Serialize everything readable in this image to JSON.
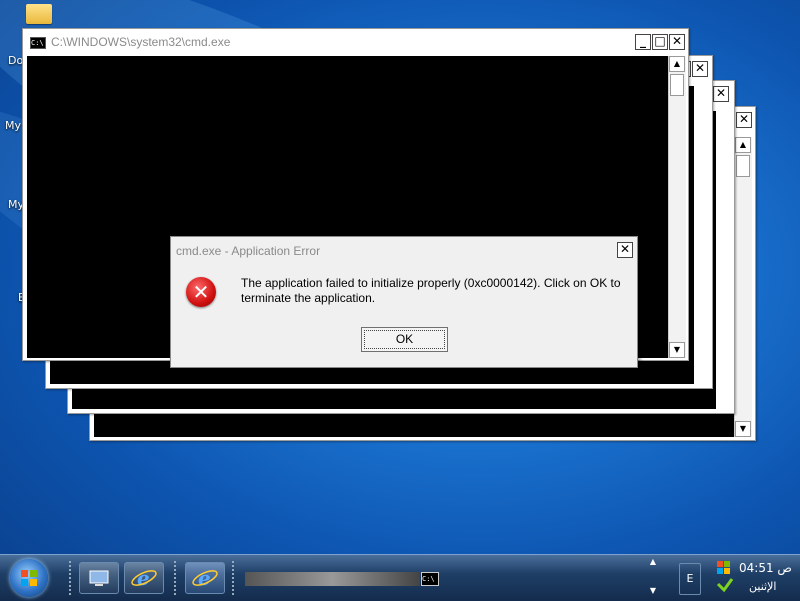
{
  "desktop": {
    "icon_labels": [
      "Do",
      "My",
      "My",
      "E"
    ]
  },
  "windows": {
    "cmd_title": "C:\\WINDOWS\\system32\\cmd.exe",
    "cmd_icon_text": "C:\\",
    "minimize_glyph": "_",
    "maximize_glyph": "□",
    "close_glyph": "✕",
    "scroll_up_glyph": "▲",
    "scroll_down_glyph": "▼"
  },
  "dialog": {
    "title": "cmd.exe - Application Error",
    "message": "The application failed to initialize properly (0xc0000142). Click on OK to terminate the application.",
    "ok_label": "OK",
    "error_glyph": "✕",
    "close_glyph": "✕"
  },
  "taskbar": {
    "task_icon_text": "C:\\",
    "show_desktop_label": "E",
    "time": "04:51 ص",
    "day": "الإثنين"
  },
  "colors": {
    "desktop": "#1a72cf",
    "error": "#d01010",
    "console": "#000000"
  }
}
